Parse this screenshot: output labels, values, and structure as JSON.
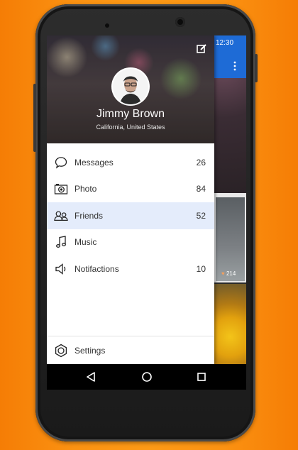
{
  "status_bar": {
    "time": "12:30"
  },
  "drawer": {
    "user": {
      "name": "Jimmy Brown",
      "location": "California, United States"
    },
    "menu": [
      {
        "label": "Messages",
        "count": "26",
        "icon": "speech-bubble-icon"
      },
      {
        "label": "Photo",
        "count": "84",
        "icon": "camera-icon"
      },
      {
        "label": "Friends",
        "count": "52",
        "icon": "people-icon",
        "active": true
      },
      {
        "label": "Music",
        "count": "",
        "icon": "music-note-icon"
      },
      {
        "label": "Notifactions",
        "count": "10",
        "icon": "speaker-icon"
      }
    ],
    "settings_label": "Settings"
  },
  "background_feed": {
    "likes": "214"
  },
  "colors": {
    "accent": "#1e6bd6",
    "active_row": "#e4ecfb",
    "page_bg": "#fc9a16"
  },
  "nav": {
    "back_icon": "back-triangle-icon",
    "home_icon": "home-circle-icon",
    "recents_icon": "recents-square-icon"
  }
}
